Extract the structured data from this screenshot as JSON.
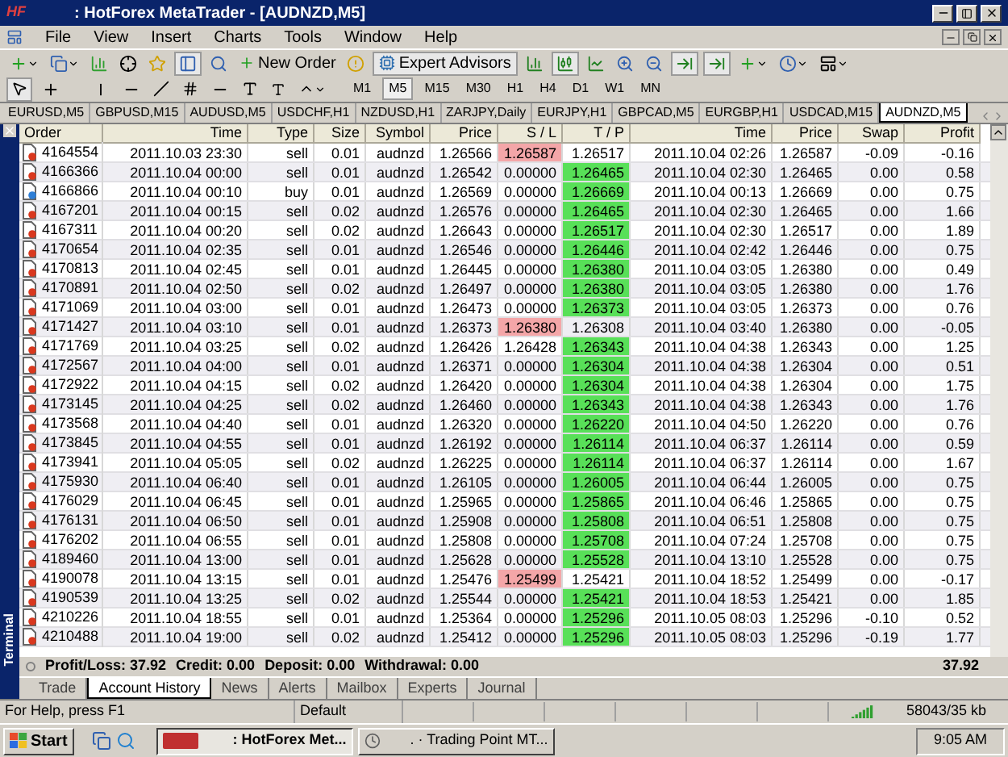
{
  "window": {
    "logo": "HF",
    "title": ": HotForex MetaTrader - [AUDNZD,M5]"
  },
  "menu": [
    "File",
    "View",
    "Insert",
    "Charts",
    "Tools",
    "Window",
    "Help"
  ],
  "toolbar": {
    "new_order": "New Order",
    "expert_advisors": "Expert Advisors"
  },
  "timeframes": [
    {
      "label": "M1",
      "selected": false
    },
    {
      "label": "M5",
      "selected": true
    },
    {
      "label": "M15",
      "selected": false
    },
    {
      "label": "M30",
      "selected": false
    },
    {
      "label": "H1",
      "selected": false
    },
    {
      "label": "H4",
      "selected": false
    },
    {
      "label": "D1",
      "selected": false
    },
    {
      "label": "W1",
      "selected": false
    },
    {
      "label": "MN",
      "selected": false
    }
  ],
  "chart_tabs": [
    {
      "label": "EURUSD,M5",
      "selected": false
    },
    {
      "label": "GBPUSD,M15",
      "selected": false
    },
    {
      "label": "AUDUSD,M5",
      "selected": false
    },
    {
      "label": "USDCHF,H1",
      "selected": false
    },
    {
      "label": "NZDUSD,H1",
      "selected": false
    },
    {
      "label": "ZARJPY,Daily",
      "selected": false
    },
    {
      "label": "EURJPY,H1",
      "selected": false
    },
    {
      "label": "GBPCAD,M5",
      "selected": false
    },
    {
      "label": "EURGBP,H1",
      "selected": false
    },
    {
      "label": "USDCAD,M15",
      "selected": false
    },
    {
      "label": "AUDNZD,M5",
      "selected": true
    }
  ],
  "terminal": {
    "label": "Terminal",
    "table": {
      "columns": [
        "Order",
        "Time",
        "Type",
        "Size",
        "Symbol",
        "Price",
        "S / L",
        "T / P",
        "Time",
        "Price",
        "Swap",
        "Profit"
      ],
      "rows": [
        {
          "kind": "sell",
          "sl_hit": true,
          "tp_hit": false,
          "cells": [
            "4164554",
            "2011.10.03 23:30",
            "sell",
            "0.01",
            "audnzd",
            "1.26566",
            "1.26587",
            "1.26517",
            "2011.10.04 02:26",
            "1.26587",
            "-0.09",
            "-0.16"
          ]
        },
        {
          "kind": "sell",
          "sl_hit": false,
          "tp_hit": true,
          "cells": [
            "4166366",
            "2011.10.04 00:00",
            "sell",
            "0.01",
            "audnzd",
            "1.26542",
            "0.00000",
            "1.26465",
            "2011.10.04 02:30",
            "1.26465",
            "0.00",
            "0.58"
          ]
        },
        {
          "kind": "buy",
          "sl_hit": false,
          "tp_hit": true,
          "cells": [
            "4166866",
            "2011.10.04 00:10",
            "buy",
            "0.01",
            "audnzd",
            "1.26569",
            "0.00000",
            "1.26669",
            "2011.10.04 00:13",
            "1.26669",
            "0.00",
            "0.75"
          ]
        },
        {
          "kind": "sell",
          "sl_hit": false,
          "tp_hit": true,
          "cells": [
            "4167201",
            "2011.10.04 00:15",
            "sell",
            "0.02",
            "audnzd",
            "1.26576",
            "0.00000",
            "1.26465",
            "2011.10.04 02:30",
            "1.26465",
            "0.00",
            "1.66"
          ]
        },
        {
          "kind": "sell",
          "sl_hit": false,
          "tp_hit": true,
          "cells": [
            "4167311",
            "2011.10.04 00:20",
            "sell",
            "0.02",
            "audnzd",
            "1.26643",
            "0.00000",
            "1.26517",
            "2011.10.04 02:30",
            "1.26517",
            "0.00",
            "1.89"
          ]
        },
        {
          "kind": "sell",
          "sl_hit": false,
          "tp_hit": true,
          "cells": [
            "4170654",
            "2011.10.04 02:35",
            "sell",
            "0.01",
            "audnzd",
            "1.26546",
            "0.00000",
            "1.26446",
            "2011.10.04 02:42",
            "1.26446",
            "0.00",
            "0.75"
          ]
        },
        {
          "kind": "sell",
          "sl_hit": false,
          "tp_hit": true,
          "cells": [
            "4170813",
            "2011.10.04 02:45",
            "sell",
            "0.01",
            "audnzd",
            "1.26445",
            "0.00000",
            "1.26380",
            "2011.10.04 03:05",
            "1.26380",
            "0.00",
            "0.49"
          ]
        },
        {
          "kind": "sell",
          "sl_hit": false,
          "tp_hit": true,
          "cells": [
            "4170891",
            "2011.10.04 02:50",
            "sell",
            "0.02",
            "audnzd",
            "1.26497",
            "0.00000",
            "1.26380",
            "2011.10.04 03:05",
            "1.26380",
            "0.00",
            "1.76"
          ]
        },
        {
          "kind": "sell",
          "sl_hit": false,
          "tp_hit": true,
          "cells": [
            "4171069",
            "2011.10.04 03:00",
            "sell",
            "0.01",
            "audnzd",
            "1.26473",
            "0.00000",
            "1.26373",
            "2011.10.04 03:05",
            "1.26373",
            "0.00",
            "0.76"
          ]
        },
        {
          "kind": "sell",
          "sl_hit": true,
          "tp_hit": false,
          "cells": [
            "4171427",
            "2011.10.04 03:10",
            "sell",
            "0.01",
            "audnzd",
            "1.26373",
            "1.26380",
            "1.26308",
            "2011.10.04 03:40",
            "1.26380",
            "0.00",
            "-0.05"
          ]
        },
        {
          "kind": "sell",
          "sl_hit": false,
          "tp_hit": true,
          "cells": [
            "4171769",
            "2011.10.04 03:25",
            "sell",
            "0.02",
            "audnzd",
            "1.26426",
            "1.26428",
            "1.26343",
            "2011.10.04 04:38",
            "1.26343",
            "0.00",
            "1.25"
          ]
        },
        {
          "kind": "sell",
          "sl_hit": false,
          "tp_hit": true,
          "cells": [
            "4172567",
            "2011.10.04 04:00",
            "sell",
            "0.01",
            "audnzd",
            "1.26371",
            "0.00000",
            "1.26304",
            "2011.10.04 04:38",
            "1.26304",
            "0.00",
            "0.51"
          ]
        },
        {
          "kind": "sell",
          "sl_hit": false,
          "tp_hit": true,
          "cells": [
            "4172922",
            "2011.10.04 04:15",
            "sell",
            "0.02",
            "audnzd",
            "1.26420",
            "0.00000",
            "1.26304",
            "2011.10.04 04:38",
            "1.26304",
            "0.00",
            "1.75"
          ]
        },
        {
          "kind": "sell",
          "sl_hit": false,
          "tp_hit": true,
          "cells": [
            "4173145",
            "2011.10.04 04:25",
            "sell",
            "0.02",
            "audnzd",
            "1.26460",
            "0.00000",
            "1.26343",
            "2011.10.04 04:38",
            "1.26343",
            "0.00",
            "1.76"
          ]
        },
        {
          "kind": "sell",
          "sl_hit": false,
          "tp_hit": true,
          "cells": [
            "4173568",
            "2011.10.04 04:40",
            "sell",
            "0.01",
            "audnzd",
            "1.26320",
            "0.00000",
            "1.26220",
            "2011.10.04 04:50",
            "1.26220",
            "0.00",
            "0.76"
          ]
        },
        {
          "kind": "sell",
          "sl_hit": false,
          "tp_hit": true,
          "cells": [
            "4173845",
            "2011.10.04 04:55",
            "sell",
            "0.01",
            "audnzd",
            "1.26192",
            "0.00000",
            "1.26114",
            "2011.10.04 06:37",
            "1.26114",
            "0.00",
            "0.59"
          ]
        },
        {
          "kind": "sell",
          "sl_hit": false,
          "tp_hit": true,
          "cells": [
            "4173941",
            "2011.10.04 05:05",
            "sell",
            "0.02",
            "audnzd",
            "1.26225",
            "0.00000",
            "1.26114",
            "2011.10.04 06:37",
            "1.26114",
            "0.00",
            "1.67"
          ]
        },
        {
          "kind": "sell",
          "sl_hit": false,
          "tp_hit": true,
          "cells": [
            "4175930",
            "2011.10.04 06:40",
            "sell",
            "0.01",
            "audnzd",
            "1.26105",
            "0.00000",
            "1.26005",
            "2011.10.04 06:44",
            "1.26005",
            "0.00",
            "0.75"
          ]
        },
        {
          "kind": "sell",
          "sl_hit": false,
          "tp_hit": true,
          "cells": [
            "4176029",
            "2011.10.04 06:45",
            "sell",
            "0.01",
            "audnzd",
            "1.25965",
            "0.00000",
            "1.25865",
            "2011.10.04 06:46",
            "1.25865",
            "0.00",
            "0.75"
          ]
        },
        {
          "kind": "sell",
          "sl_hit": false,
          "tp_hit": true,
          "cells": [
            "4176131",
            "2011.10.04 06:50",
            "sell",
            "0.01",
            "audnzd",
            "1.25908",
            "0.00000",
            "1.25808",
            "2011.10.04 06:51",
            "1.25808",
            "0.00",
            "0.75"
          ]
        },
        {
          "kind": "sell",
          "sl_hit": false,
          "tp_hit": true,
          "cells": [
            "4176202",
            "2011.10.04 06:55",
            "sell",
            "0.01",
            "audnzd",
            "1.25808",
            "0.00000",
            "1.25708",
            "2011.10.04 07:24",
            "1.25708",
            "0.00",
            "0.75"
          ]
        },
        {
          "kind": "sell",
          "sl_hit": false,
          "tp_hit": true,
          "cells": [
            "4189460",
            "2011.10.04 13:00",
            "sell",
            "0.01",
            "audnzd",
            "1.25628",
            "0.00000",
            "1.25528",
            "2011.10.04 13:10",
            "1.25528",
            "0.00",
            "0.75"
          ]
        },
        {
          "kind": "sell",
          "sl_hit": true,
          "tp_hit": false,
          "cells": [
            "4190078",
            "2011.10.04 13:15",
            "sell",
            "0.01",
            "audnzd",
            "1.25476",
            "1.25499",
            "1.25421",
            "2011.10.04 18:52",
            "1.25499",
            "0.00",
            "-0.17"
          ]
        },
        {
          "kind": "sell",
          "sl_hit": false,
          "tp_hit": true,
          "cells": [
            "4190539",
            "2011.10.04 13:25",
            "sell",
            "0.02",
            "audnzd",
            "1.25544",
            "0.00000",
            "1.25421",
            "2011.10.04 18:53",
            "1.25421",
            "0.00",
            "1.85"
          ]
        },
        {
          "kind": "sell",
          "sl_hit": false,
          "tp_hit": true,
          "cells": [
            "4210226",
            "2011.10.04 18:55",
            "sell",
            "0.01",
            "audnzd",
            "1.25364",
            "0.00000",
            "1.25296",
            "2011.10.05 08:03",
            "1.25296",
            "-0.10",
            "0.52"
          ]
        },
        {
          "kind": "sell",
          "sl_hit": false,
          "tp_hit": true,
          "cells": [
            "4210488",
            "2011.10.04 19:00",
            "sell",
            "0.02",
            "audnzd",
            "1.25412",
            "0.00000",
            "1.25296",
            "2011.10.05 08:03",
            "1.25296",
            "-0.19",
            "1.77"
          ]
        }
      ],
      "summary": [
        "Profit/Loss: 37.92",
        "Credit: 0.00",
        "Deposit: 0.00",
        "Withdrawal: 0.00"
      ],
      "total": "37.92"
    },
    "tabs": [
      {
        "label": "Trade",
        "selected": false
      },
      {
        "label": "Account History",
        "selected": true
      },
      {
        "label": "News",
        "selected": false
      },
      {
        "label": "Alerts",
        "selected": false
      },
      {
        "label": "Mailbox",
        "selected": false
      },
      {
        "label": "Experts",
        "selected": false
      },
      {
        "label": "Journal",
        "selected": false
      }
    ]
  },
  "status_bar": {
    "help": "For Help, press F1",
    "profile": "Default",
    "traffic": "58043/35 kb"
  },
  "taskbar": {
    "start": "Start",
    "tasks": [
      {
        "label": ": HotForex Met...",
        "kind": "hf",
        "selected": true
      },
      {
        "label": ". · Trading Point MT...",
        "kind": "mt",
        "selected": false
      }
    ],
    "clock": "9:05 AM"
  }
}
